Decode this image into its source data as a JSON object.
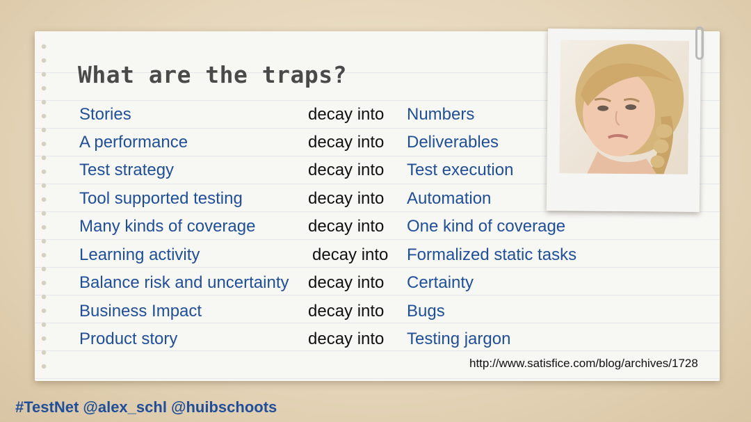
{
  "title": "What are the traps?",
  "rows": [
    {
      "left": "Stories",
      "mid": "decay into",
      "right": "Numbers"
    },
    {
      "left": "A performance",
      "mid": "decay into",
      "right": "Deliverables"
    },
    {
      "left": "Test strategy",
      "mid": "decay into",
      "right": "Test execution"
    },
    {
      "left": "Tool supported testing",
      "mid": "decay into",
      "right": "Automation"
    },
    {
      "left": "Many kinds of coverage",
      "mid": "decay into",
      "right": "One kind of coverage"
    },
    {
      "left": "Learning activity",
      "mid": "decay into",
      "right": "Formalized static tasks"
    },
    {
      "left": "Balance risk and uncertainty",
      "mid": "decay into",
      "right": "Certainty"
    },
    {
      "left": "Business Impact",
      "mid": "decay into",
      "right": "Bugs"
    },
    {
      "left": "Product story",
      "mid": "decay into",
      "right": "Testing jargon"
    }
  ],
  "url": "http://www.satisfice.com/blog/archives/1728",
  "footer": "#TestNet @alex_schl @huibschoots",
  "colors": {
    "background": "#e6d6ba",
    "paper": "#f7f7f4",
    "blue_text": "#1f4f9a",
    "title_text": "#4a4a4a"
  }
}
